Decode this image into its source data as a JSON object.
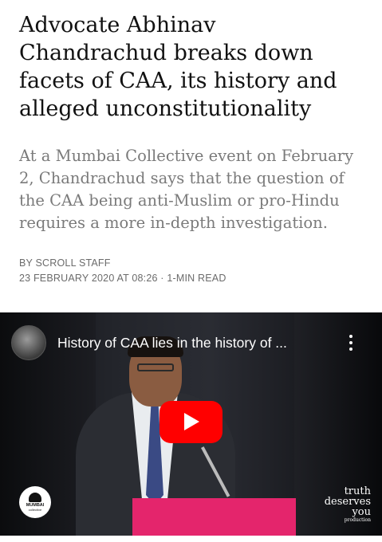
{
  "article": {
    "headline": "Advocate Abhinav Chandrachud breaks down facets of CAA, its history and alleged unconstitutionality",
    "dek": "At a Mumbai Collective event on February 2, Chandrachud says that the question of the CAA being anti-Muslim or pro-Hindu requires a more in-depth investigation.",
    "byline": "BY SCROLL STAFF",
    "dateline": "23 FEBRUARY 2020 AT 08:26 · 1-MIN READ"
  },
  "video": {
    "title": "History of CAA lies in the history of ...",
    "channel_avatar_icon": "channel-avatar",
    "menu_icon": "more-vertical-icon",
    "play_icon": "play-icon",
    "play_color": "#ff0000",
    "podium_color": "#e4256c",
    "logo": {
      "name": "MUMBAI",
      "sub": "collective"
    },
    "watermark": {
      "line1": "truth",
      "line2": "deserves",
      "line3": "you",
      "line4": "production"
    }
  }
}
